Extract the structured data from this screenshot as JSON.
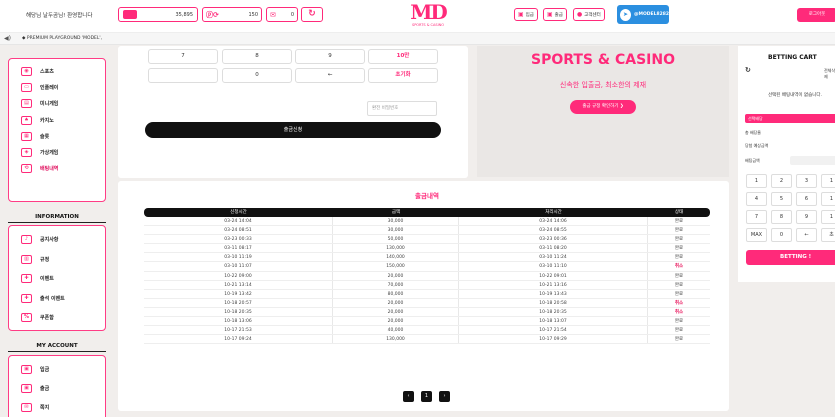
{
  "header": {
    "welcome": "해당님 날두곰님! 환영합니다",
    "balance": "35,895",
    "points": "150",
    "messages": "0",
    "logo_mark": "MD",
    "logo_sub": "SPORTS & CASINO",
    "buttons": [
      "입금",
      "출금",
      "고객센터"
    ],
    "telegram": "@MODEL8282",
    "login": "로그아웃"
  },
  "ticker": {
    "text": "◆ PREMIUM PLAYGROUND 'MODEL',"
  },
  "sidebar": {
    "games": [
      "스포츠",
      "인플레이",
      "미니게임",
      "카지노",
      "슬롯",
      "가상게임",
      "배팅내역"
    ],
    "info_title": "INFORMATION",
    "info": [
      "공지사항",
      "규정",
      "이벤트",
      "출석 이벤트",
      "쿠폰함"
    ],
    "account_title": "MY ACCOUNT",
    "account": [
      "입금",
      "출금",
      "쪽지"
    ]
  },
  "keypad": {
    "row1": [
      "7",
      "8",
      "9",
      "10만"
    ],
    "row2": [
      "",
      "0",
      "←",
      "초기화"
    ],
    "pin_placeholder": "환전 비밀번호",
    "submit": "출금신청"
  },
  "promo": {
    "brand": "SPORTS & CASINO",
    "tagline": "신속한 입출금, 최소한의 제재",
    "cta": "출금 규정 확인하기 ❯"
  },
  "cart": {
    "title": "BETTING CART",
    "delete": "전체삭제",
    "empty": "선택된 배팅내역이 없습니다.",
    "odds_label": "선택배당",
    "total_odds_label": "총 배당율",
    "win_label": "당첨 예상금액",
    "amount_label": "배팅금액",
    "keys": [
      "1",
      "2",
      "3",
      "1",
      "4",
      "5",
      "6",
      "1",
      "7",
      "8",
      "9",
      "1",
      "MAX",
      "0",
      "←",
      "초"
    ],
    "bet_button": "BETTING !"
  },
  "history": {
    "title": "출금내역",
    "columns": [
      "신청시간",
      "금액",
      "처리시간",
      "상태"
    ],
    "rows": [
      [
        "03-24 14:04",
        "30,000",
        "03-24 14:06",
        "완료"
      ],
      [
        "03-24 08:51",
        "30,000",
        "03-24 08:55",
        "완료"
      ],
      [
        "03-23 00:33",
        "50,000",
        "03-23 00:36",
        "완료"
      ],
      [
        "03-11 08:17",
        "130,000",
        "03-11 08:20",
        "완료"
      ],
      [
        "03-10 11:19",
        "140,000",
        "03-10 11:24",
        "완료"
      ],
      [
        "03-10 11:07",
        "150,000",
        "03-10 11:10",
        "취소"
      ],
      [
        "10-22 09:00",
        "20,000",
        "10-22 09:01",
        "완료"
      ],
      [
        "10-21 13:14",
        "70,000",
        "10-21 13:16",
        "완료"
      ],
      [
        "10-19 13:42",
        "80,000",
        "10-19 13:43",
        "완료"
      ],
      [
        "10-18 20:57",
        "20,000",
        "10-18 20:58",
        "취소"
      ],
      [
        "10-18 20:35",
        "20,000",
        "10-18 20:35",
        "취소"
      ],
      [
        "10-18 13:06",
        "20,000",
        "10-18 13:07",
        "완료"
      ],
      [
        "10-17 21:53",
        "40,000",
        "10-17 21:54",
        "완료"
      ],
      [
        "10-17 09:24",
        "130,000",
        "10-17 09:29",
        "완료"
      ]
    ],
    "pager": [
      "‹",
      "1",
      "›"
    ]
  },
  "colors": {
    "accent": "#ff2a7a",
    "dark": "#111111",
    "bg": "#f1eeec",
    "telegram": "#2b8fe0"
  }
}
